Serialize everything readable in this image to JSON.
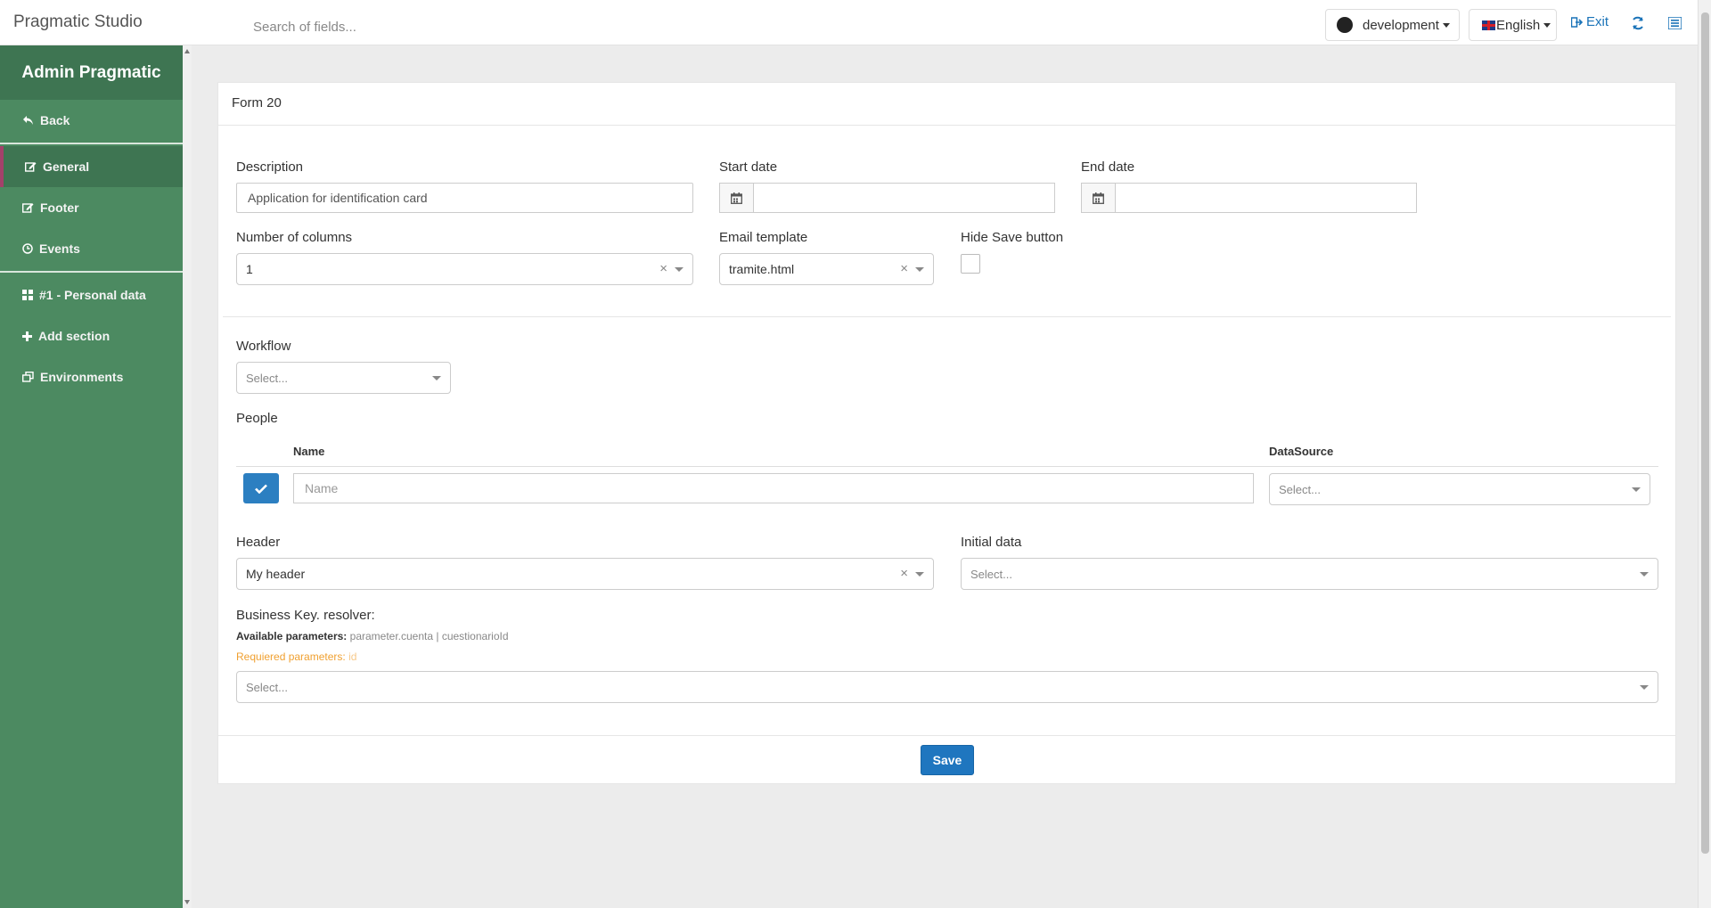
{
  "app": {
    "title": "Pragmatic Studio"
  },
  "search": {
    "placeholder": "Search of fields..."
  },
  "topbar": {
    "environment": "development",
    "language": "English",
    "exit_label": "Exit"
  },
  "sidebar": {
    "title": "Admin Pragmatic",
    "items": [
      {
        "label": "Back",
        "icon": "reply-icon"
      },
      {
        "label": "General",
        "icon": "edit-icon"
      },
      {
        "label": "Footer",
        "icon": "edit-icon"
      },
      {
        "label": "Events",
        "icon": "clock-icon"
      },
      {
        "label": "#1 - Personal data",
        "icon": "grid-icon"
      },
      {
        "label": "Add section",
        "icon": "plus-icon"
      },
      {
        "label": "Environments",
        "icon": "windows-icon"
      }
    ]
  },
  "form": {
    "title": "Form 20",
    "description": {
      "label": "Description",
      "value": "Application for identification card"
    },
    "start_date": {
      "label": "Start date",
      "value": ""
    },
    "end_date": {
      "label": "End date",
      "value": ""
    },
    "columns": {
      "label": "Number of columns",
      "value": "1"
    },
    "email_template": {
      "label": "Email template",
      "value": "tramite.html"
    },
    "hide_save": {
      "label": "Hide Save button",
      "checked": false
    },
    "workflow": {
      "label": "Workflow",
      "placeholder": "Select..."
    },
    "people": {
      "label": "People",
      "col_name": "Name",
      "col_datasource": "DataSource",
      "name_placeholder": "Name",
      "datasource_placeholder": "Select..."
    },
    "header": {
      "label": "Header",
      "value": "My header"
    },
    "initial_data": {
      "label": "Initial data",
      "placeholder": "Select..."
    },
    "business_key": {
      "label": "Business Key. resolver:",
      "available_label": "Available parameters:",
      "available_values": "parameter.cuenta | cuestionarioId",
      "required_label": "Requiered parameters:",
      "required_values": "id",
      "placeholder": "Select..."
    },
    "save_label": "Save"
  },
  "colors": {
    "sidebar": "#4c8a61",
    "sidebar_active": "#3e7552",
    "primary": "#1f76bf",
    "warning": "#f0a030"
  }
}
